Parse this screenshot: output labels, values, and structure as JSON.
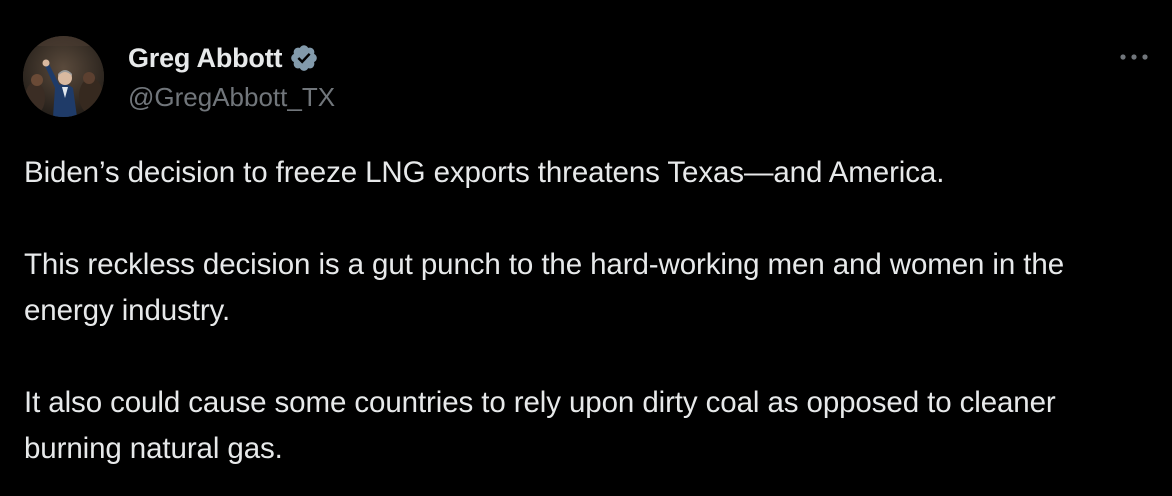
{
  "author": {
    "display_name": "Greg Abbott",
    "handle": "@GregAbbott_TX",
    "verified": true,
    "avatar_icon": "person-waving-avatar",
    "verified_icon": "verified-badge-icon"
  },
  "menu": {
    "more_icon": "more-horizontal-icon"
  },
  "tweet": {
    "paragraphs": [
      "Biden’s decision to freeze LNG exports threatens Texas—and America.",
      "This reckless decision is a gut punch to the hard-working men and women in the energy industry.",
      "It also could cause some countries to rely upon dirty coal as opposed to cleaner burning natural gas."
    ]
  },
  "colors": {
    "background": "#000000",
    "primary_text": "#e7e9ea",
    "secondary_text": "#71767b",
    "verified_badge": "#829aab"
  }
}
